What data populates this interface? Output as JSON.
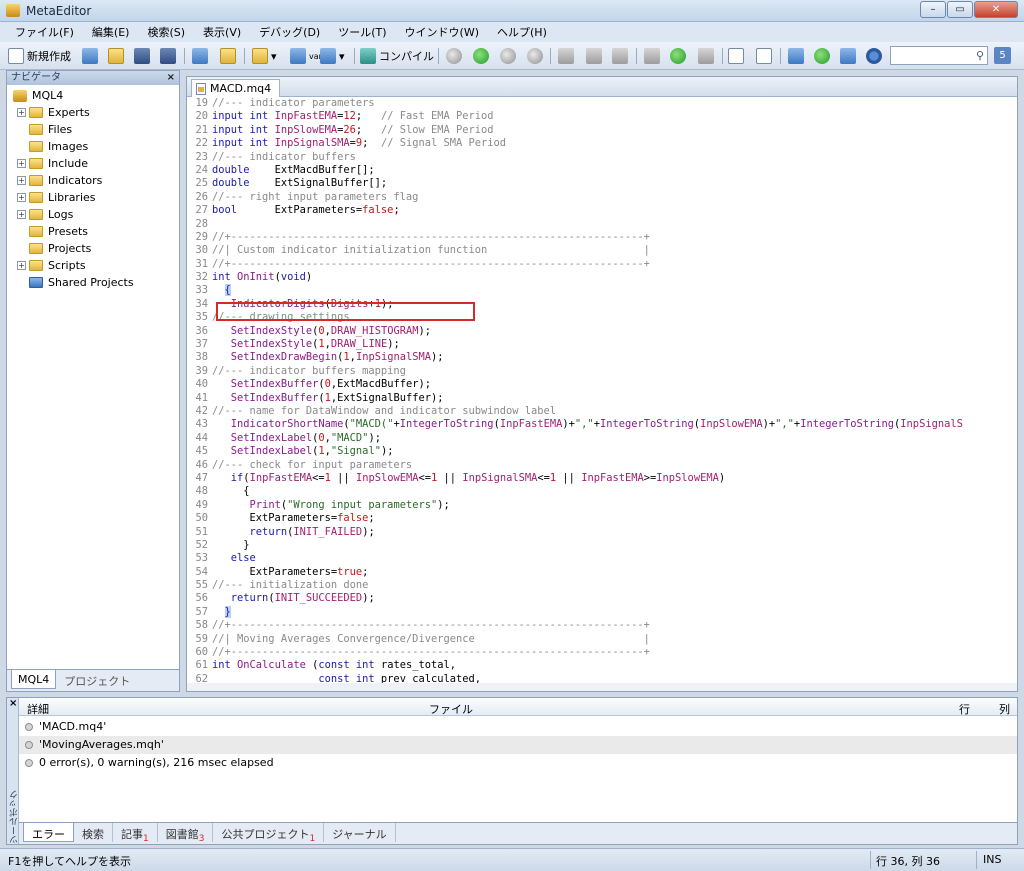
{
  "window": {
    "title": "MetaEditor",
    "min_glyph": "–",
    "max_glyph": "▭",
    "close_glyph": "✕"
  },
  "menu": [
    "ファイル(F)",
    "編集(E)",
    "検索(S)",
    "表示(V)",
    "デバッグ(D)",
    "ツール(T)",
    "ウインドウ(W)",
    "ヘルプ(H)"
  ],
  "toolbar": {
    "new_label": "新規作成",
    "compile_label": "コンパイル",
    "var_label": "var",
    "num_badge": "5",
    "search_placeholder": ""
  },
  "navigator": {
    "title": "ナビゲータ",
    "close": "×",
    "root": "MQL4",
    "items": [
      {
        "label": "Experts",
        "expandable": true
      },
      {
        "label": "Files",
        "expandable": false
      },
      {
        "label": "Images",
        "expandable": false
      },
      {
        "label": "Include",
        "expandable": true
      },
      {
        "label": "Indicators",
        "expandable": true
      },
      {
        "label": "Libraries",
        "expandable": true
      },
      {
        "label": "Logs",
        "expandable": true
      },
      {
        "label": "Presets",
        "expandable": false
      },
      {
        "label": "Projects",
        "expandable": false
      },
      {
        "label": "Scripts",
        "expandable": true
      },
      {
        "label": "Shared Projects",
        "expandable": false
      }
    ],
    "tabs": [
      "MQL4",
      "プロジェクト"
    ]
  },
  "editor": {
    "tab": "MACD.mq4",
    "lines": [
      {
        "n": "19",
        "t": [
          [
            "cm",
            "//--- indicator parameters"
          ]
        ]
      },
      {
        "n": "20",
        "t": [
          [
            "kw",
            "input int "
          ],
          [
            "cst",
            "InpFastEMA"
          ],
          [
            "pl",
            "="
          ],
          [
            "num",
            "12"
          ],
          [
            "pl",
            ";   "
          ],
          [
            "cm",
            "// Fast EMA Period"
          ]
        ]
      },
      {
        "n": "21",
        "t": [
          [
            "kw",
            "input int "
          ],
          [
            "cst",
            "InpSlowEMA"
          ],
          [
            "pl",
            "="
          ],
          [
            "num",
            "26"
          ],
          [
            "pl",
            ";   "
          ],
          [
            "cm",
            "// Slow EMA Period"
          ]
        ]
      },
      {
        "n": "22",
        "t": [
          [
            "kw",
            "input int "
          ],
          [
            "cst",
            "InpSignalSMA"
          ],
          [
            "pl",
            "="
          ],
          [
            "num",
            "9"
          ],
          [
            "pl",
            ";  "
          ],
          [
            "cm",
            "// Signal SMA Period"
          ]
        ]
      },
      {
        "n": "23",
        "t": [
          [
            "cm",
            "//--- indicator buffers"
          ]
        ]
      },
      {
        "n": "24",
        "t": [
          [
            "kw",
            "double    "
          ],
          [
            "pl",
            "ExtMacdBuffer[];"
          ]
        ]
      },
      {
        "n": "25",
        "t": [
          [
            "kw",
            "double    "
          ],
          [
            "pl",
            "ExtSignalBuffer[];"
          ]
        ]
      },
      {
        "n": "26",
        "t": [
          [
            "cm",
            "//--- right input parameters flag"
          ]
        ]
      },
      {
        "n": "27",
        "t": [
          [
            "kw",
            "bool      "
          ],
          [
            "pl",
            "ExtParameters="
          ],
          [
            "num",
            "false"
          ],
          [
            "pl",
            ";"
          ]
        ]
      },
      {
        "n": "28",
        "t": []
      },
      {
        "n": "29",
        "t": [
          [
            "cm",
            "//+------------------------------------------------------------------+"
          ]
        ]
      },
      {
        "n": "30",
        "t": [
          [
            "cm",
            "//| Custom indicator initialization function                         |"
          ]
        ]
      },
      {
        "n": "31",
        "t": [
          [
            "cm",
            "//+------------------------------------------------------------------+"
          ]
        ]
      },
      {
        "n": "32",
        "t": [
          [
            "kw",
            "int "
          ],
          [
            "fn",
            "OnInit"
          ],
          [
            "pl",
            "("
          ],
          [
            "kw",
            "void"
          ],
          [
            "pl",
            ")"
          ]
        ]
      },
      {
        "n": "33",
        "t": [
          [
            "pl",
            "  "
          ],
          [
            "brace",
            "{"
          ]
        ]
      },
      {
        "n": "34",
        "t": [
          [
            "pl",
            "   "
          ],
          [
            "fn",
            "IndicatorDigits"
          ],
          [
            "pl",
            "("
          ],
          [
            "cst",
            "Digits"
          ],
          [
            "pl",
            "+"
          ],
          [
            "num",
            "1"
          ],
          [
            "pl",
            ");"
          ]
        ]
      },
      {
        "n": "35",
        "t": [
          [
            "cm",
            "//--- drawing settings"
          ]
        ]
      },
      {
        "n": "36",
        "t": [
          [
            "pl",
            "   "
          ],
          [
            "fn",
            "SetIndexStyle"
          ],
          [
            "pl",
            "("
          ],
          [
            "num",
            "0"
          ],
          [
            "pl",
            ","
          ],
          [
            "cst",
            "DRAW_HISTOGRAM"
          ],
          [
            "pl",
            ");"
          ]
        ]
      },
      {
        "n": "37",
        "t": [
          [
            "pl",
            "   "
          ],
          [
            "fn",
            "SetIndexStyle"
          ],
          [
            "pl",
            "("
          ],
          [
            "num",
            "1"
          ],
          [
            "pl",
            ","
          ],
          [
            "cst",
            "DRAW_LINE"
          ],
          [
            "pl",
            ");"
          ]
        ]
      },
      {
        "n": "38",
        "t": [
          [
            "pl",
            "   "
          ],
          [
            "fn",
            "SetIndexDrawBegin"
          ],
          [
            "pl",
            "("
          ],
          [
            "num",
            "1"
          ],
          [
            "pl",
            ","
          ],
          [
            "cst",
            "InpSignalSMA"
          ],
          [
            "pl",
            ");"
          ]
        ]
      },
      {
        "n": "39",
        "t": [
          [
            "cm",
            "//--- indicator buffers mapping"
          ]
        ]
      },
      {
        "n": "40",
        "t": [
          [
            "pl",
            "   "
          ],
          [
            "fn",
            "SetIndexBuffer"
          ],
          [
            "pl",
            "("
          ],
          [
            "num",
            "0"
          ],
          [
            "pl",
            ",ExtMacdBuffer);"
          ]
        ]
      },
      {
        "n": "41",
        "t": [
          [
            "pl",
            "   "
          ],
          [
            "fn",
            "SetIndexBuffer"
          ],
          [
            "pl",
            "("
          ],
          [
            "num",
            "1"
          ],
          [
            "pl",
            ",ExtSignalBuffer);"
          ]
        ]
      },
      {
        "n": "42",
        "t": [
          [
            "cm",
            "//--- name for DataWindow and indicator subwindow label"
          ]
        ]
      },
      {
        "n": "43",
        "t": [
          [
            "pl",
            "   "
          ],
          [
            "fn",
            "IndicatorShortName"
          ],
          [
            "pl",
            "("
          ],
          [
            "str",
            "\"MACD(\""
          ],
          [
            "pl",
            "+"
          ],
          [
            "fn",
            "IntegerToString"
          ],
          [
            "pl",
            "("
          ],
          [
            "cst",
            "InpFastEMA"
          ],
          [
            "pl",
            ")+"
          ],
          [
            "str",
            "\",\""
          ],
          [
            "pl",
            "+"
          ],
          [
            "fn",
            "IntegerToString"
          ],
          [
            "pl",
            "("
          ],
          [
            "cst",
            "InpSlowEMA"
          ],
          [
            "pl",
            ")+"
          ],
          [
            "str",
            "\",\""
          ],
          [
            "pl",
            "+"
          ],
          [
            "fn",
            "IntegerToString"
          ],
          [
            "pl",
            "("
          ],
          [
            "cst",
            "InpSignalS"
          ]
        ]
      },
      {
        "n": "44",
        "t": [
          [
            "pl",
            "   "
          ],
          [
            "fn",
            "SetIndexLabel"
          ],
          [
            "pl",
            "("
          ],
          [
            "num",
            "0"
          ],
          [
            "pl",
            ","
          ],
          [
            "str",
            "\"MACD\""
          ],
          [
            "pl",
            ");"
          ]
        ]
      },
      {
        "n": "45",
        "t": [
          [
            "pl",
            "   "
          ],
          [
            "fn",
            "SetIndexLabel"
          ],
          [
            "pl",
            "("
          ],
          [
            "num",
            "1"
          ],
          [
            "pl",
            ","
          ],
          [
            "str",
            "\"Signal\""
          ],
          [
            "pl",
            ");"
          ]
        ]
      },
      {
        "n": "46",
        "t": [
          [
            "cm",
            "//--- check for input parameters"
          ]
        ]
      },
      {
        "n": "47",
        "t": [
          [
            "pl",
            "   "
          ],
          [
            "kw",
            "if"
          ],
          [
            "pl",
            "("
          ],
          [
            "cst",
            "InpFastEMA"
          ],
          [
            "pl",
            "<="
          ],
          [
            "num",
            "1"
          ],
          [
            "pl",
            " || "
          ],
          [
            "cst",
            "InpSlowEMA"
          ],
          [
            "pl",
            "<="
          ],
          [
            "num",
            "1"
          ],
          [
            "pl",
            " || "
          ],
          [
            "cst",
            "InpSignalSMA"
          ],
          [
            "pl",
            "<="
          ],
          [
            "num",
            "1"
          ],
          [
            "pl",
            " || "
          ],
          [
            "cst",
            "InpFastEMA"
          ],
          [
            "pl",
            ">="
          ],
          [
            "cst",
            "InpSlowEMA"
          ],
          [
            "pl",
            ")"
          ]
        ]
      },
      {
        "n": "48",
        "t": [
          [
            "pl",
            "     {"
          ]
        ]
      },
      {
        "n": "49",
        "t": [
          [
            "pl",
            "      "
          ],
          [
            "fn",
            "Print"
          ],
          [
            "pl",
            "("
          ],
          [
            "str",
            "\"Wrong input parameters\""
          ],
          [
            "pl",
            ");"
          ]
        ]
      },
      {
        "n": "50",
        "t": [
          [
            "pl",
            "      ExtParameters="
          ],
          [
            "num",
            "false"
          ],
          [
            "pl",
            ";"
          ]
        ]
      },
      {
        "n": "51",
        "t": [
          [
            "pl",
            "      "
          ],
          [
            "kw",
            "return"
          ],
          [
            "pl",
            "("
          ],
          [
            "cst",
            "INIT_FAILED"
          ],
          [
            "pl",
            ");"
          ]
        ]
      },
      {
        "n": "52",
        "t": [
          [
            "pl",
            "     }"
          ]
        ]
      },
      {
        "n": "53",
        "t": [
          [
            "pl",
            "   "
          ],
          [
            "kw",
            "else"
          ]
        ]
      },
      {
        "n": "54",
        "t": [
          [
            "pl",
            "      ExtParameters="
          ],
          [
            "num",
            "true"
          ],
          [
            "pl",
            ";"
          ]
        ]
      },
      {
        "n": "55",
        "t": [
          [
            "cm",
            "//--- initialization done"
          ]
        ]
      },
      {
        "n": "56",
        "t": [
          [
            "pl",
            "   "
          ],
          [
            "kw",
            "return"
          ],
          [
            "pl",
            "("
          ],
          [
            "cst",
            "INIT_SUCCEEDED"
          ],
          [
            "pl",
            ");"
          ]
        ]
      },
      {
        "n": "57",
        "t": [
          [
            "pl",
            "  "
          ],
          [
            "brace",
            "}"
          ]
        ]
      },
      {
        "n": "58",
        "t": [
          [
            "cm",
            "//+------------------------------------------------------------------+"
          ]
        ]
      },
      {
        "n": "59",
        "t": [
          [
            "cm",
            "//| Moving Averages Convergence/Divergence                           |"
          ]
        ]
      },
      {
        "n": "60",
        "t": [
          [
            "cm",
            "//+------------------------------------------------------------------+"
          ]
        ]
      },
      {
        "n": "61",
        "t": [
          [
            "kw",
            "int "
          ],
          [
            "fn",
            "OnCalculate"
          ],
          [
            "pl",
            " ("
          ],
          [
            "kw",
            "const int "
          ],
          [
            "pl",
            "rates_total,"
          ]
        ]
      },
      {
        "n": "62",
        "t": [
          [
            "pl",
            "                 "
          ],
          [
            "kw",
            "const int "
          ],
          [
            "pl",
            "prev_calculated,"
          ]
        ]
      }
    ]
  },
  "toolbox": {
    "headers": {
      "detail": "詳細",
      "file": "ファイル",
      "row": "行",
      "col": "列"
    },
    "rows": [
      "'MACD.mq4'",
      "'MovingAverages.mqh'",
      "0 error(s), 0 warning(s), 216 msec elapsed"
    ],
    "side_label": "ツールボックス",
    "tabs": [
      {
        "label": "エラー",
        "badge": ""
      },
      {
        "label": "検索",
        "badge": ""
      },
      {
        "label": "記事",
        "badge": "1"
      },
      {
        "label": "図書館",
        "badge": "3"
      },
      {
        "label": "公共プロジェクト",
        "badge": "1"
      },
      {
        "label": "ジャーナル",
        "badge": ""
      }
    ]
  },
  "status": {
    "help": "F1を押してヘルプを表示",
    "position": "行 36, 列 36",
    "mode": "INS"
  }
}
